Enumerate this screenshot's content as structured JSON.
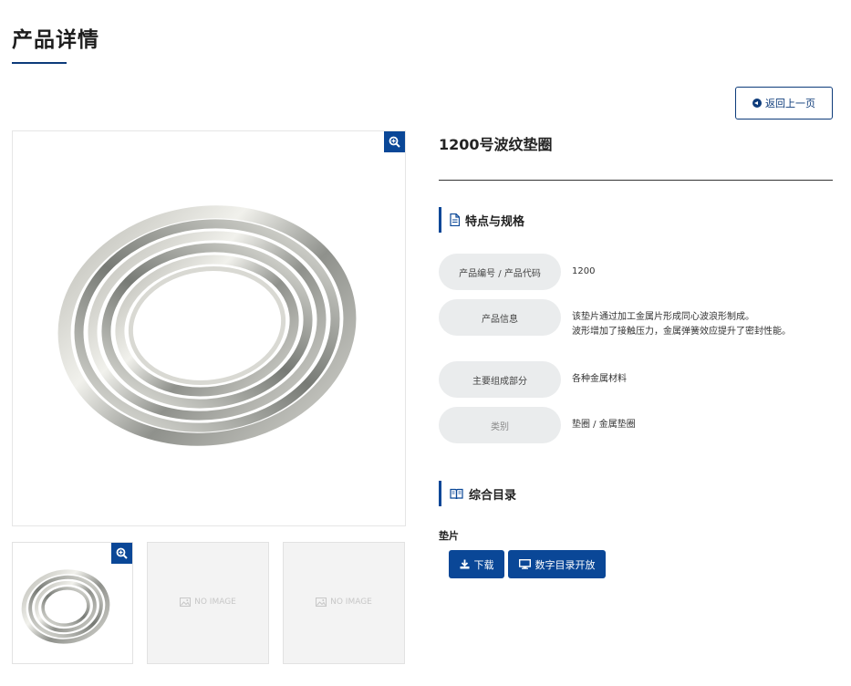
{
  "page": {
    "title": "产品详情",
    "back_label": "返回上一页"
  },
  "product": {
    "name": "1200号波纹垫圈",
    "gallery": {
      "no_image_text": "NO IMAGE"
    }
  },
  "specs": {
    "section_title": "特点与规格",
    "rows": [
      {
        "label": "产品编号 / 产品代码",
        "value": "1200"
      },
      {
        "label": "产品信息",
        "value": "该垫片通过加工金属片形成同心波浪形制成。",
        "value2": "波形增加了接触压力，金属弹簧效应提升了密封性能。"
      },
      {
        "label": "主要组成部分",
        "value": "各种金属材料"
      },
      {
        "label": "类别",
        "value": "垫圈 / 金属垫圈"
      }
    ]
  },
  "catalog": {
    "section_title": "综合目录",
    "item_title": "垫片",
    "download_label": "下载",
    "digital_label": "数字目录开放"
  },
  "colors": {
    "accent": "#0a4797",
    "label_bg": "#eaeced"
  }
}
